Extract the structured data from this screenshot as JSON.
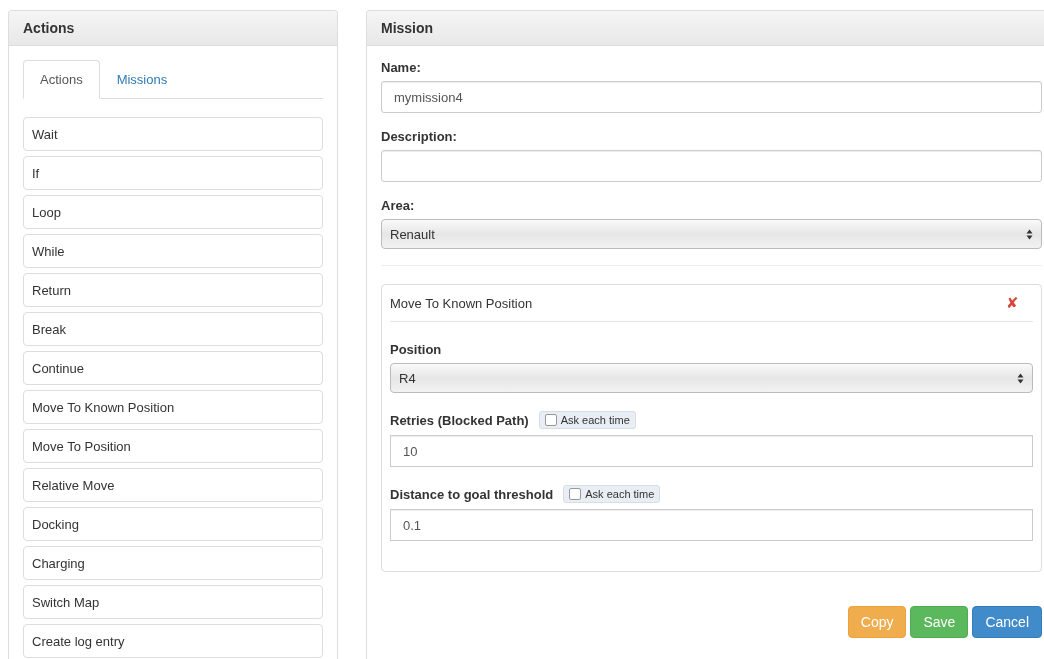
{
  "actions_panel": {
    "title": "Actions",
    "tabs": [
      {
        "label": "Actions",
        "selected": true
      },
      {
        "label": "Missions",
        "selected": false
      }
    ],
    "items": [
      "Wait",
      "If",
      "Loop",
      "While",
      "Return",
      "Break",
      "Continue",
      "Move To Known Position",
      "Move To Position",
      "Relative Move",
      "Docking",
      "Charging",
      "Switch Map",
      "Create log entry"
    ]
  },
  "mission_panel": {
    "title": "Mission",
    "fields": [
      {
        "kind": "text",
        "label": "Name:",
        "value": "mymission4"
      },
      {
        "kind": "text",
        "label": "Description:"
      },
      {
        "kind": "select",
        "label": "Area:",
        "value": "Renault"
      }
    ],
    "action_card": {
      "title": "Move To Known Position",
      "remove_icon": "✘",
      "fields": [
        {
          "kind": "select",
          "label": "Position",
          "value": "R4"
        },
        {
          "kind": "text",
          "label": "Retries (Blocked Path)",
          "value": "10",
          "ask": {
            "label": "Ask each time",
            "checked": false
          }
        },
        {
          "kind": "text",
          "label": "Distance to goal threshold",
          "value": "0.1",
          "ask": {
            "label": "Ask each time",
            "checked": false
          }
        }
      ]
    },
    "buttons": [
      {
        "label": "Copy",
        "kind": "warning"
      },
      {
        "label": "Save",
        "kind": "success"
      },
      {
        "label": "Cancel",
        "kind": "primary"
      }
    ]
  }
}
